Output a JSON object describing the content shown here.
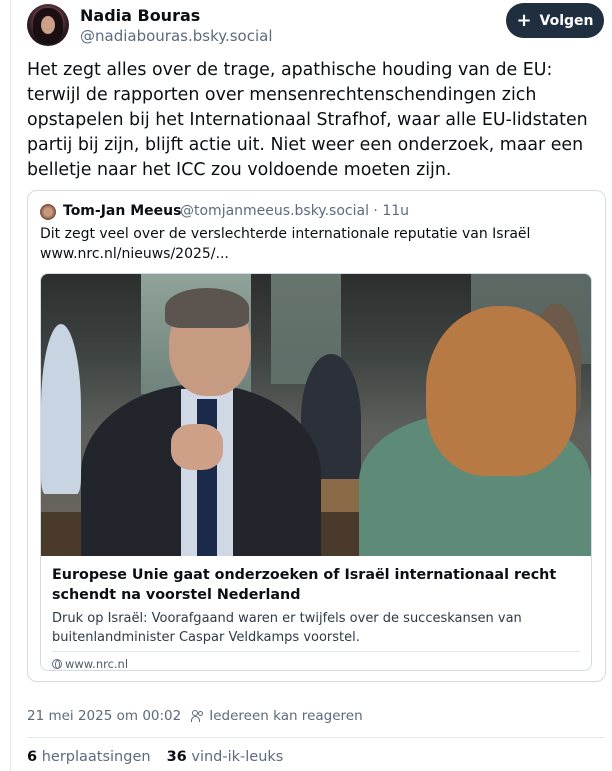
{
  "post": {
    "author_name": "Nadia Bouras",
    "author_handle": "@nadiabouras.bsky.social",
    "follow_label": "Volgen",
    "text": "Het zegt alles over de trage, apathische houding van de EU: terwijl de rapporten over mensenrechtenschendingen zich opstapelen bij het Internationaal Strafhof, waar alle EU-lidstaten partij bij zijn, blijft actie uit. Niet weer een onderzoek, maar een belletje naar het ICC zou voldoende moeten zijn.",
    "timestamp": "21 mei 2025 om 00:02",
    "reply_setting": "Iedereen kan reageren",
    "reposts_count": "6",
    "reposts_label": "herplaatsingen",
    "likes_count": "36",
    "likes_label": "vind-ik-leuks"
  },
  "quote": {
    "author_name": "Tom-Jan Meeus",
    "author_handle": "@tomjanmeeus.bsky.social",
    "separator": "·",
    "age": "11u",
    "text_line1": "Dit zegt veel over de verslechterde internationale reputatie van Israël",
    "text_line2": "www.nrc.nl/nieuws/2025/...",
    "embed": {
      "title": "Europese Unie gaat onderzoeken of Israël  internationaal recht schendt na voorstel Nederland",
      "description": "Druk op Israël: Voorafgaand waren er twijfels over de succeskansen van buitenlandminister Caspar Veldkamps voorstel.",
      "domain": "www.nrc.nl"
    }
  },
  "icons": {
    "follow": "plus-icon",
    "domain": "globe-icon",
    "reply_setting": "people-icon"
  }
}
